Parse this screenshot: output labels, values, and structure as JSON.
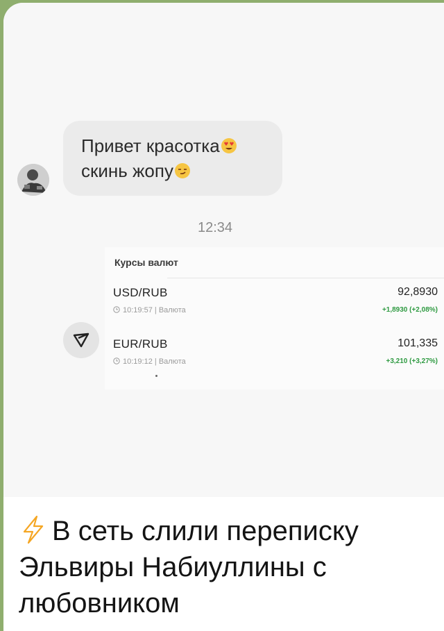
{
  "chat": {
    "message_line1": "Привет красотка",
    "message_line2": "скинь жопу",
    "time": "12:34"
  },
  "rates": {
    "title": "Курсы валют",
    "items": [
      {
        "pair": "USD/RUB",
        "time": "10:19:57",
        "source": "Валюта",
        "value": "92,8930",
        "change": "+1,8930 (+2,08%)"
      },
      {
        "pair": "EUR/RUB",
        "time": "10:19:12",
        "source": "Валюта",
        "value": "101,335",
        "change": "+3,210 (+3,27%)"
      }
    ]
  },
  "caption": {
    "line1": "В сеть слили переписку",
    "line2": "Эльвиры Набиуллины с",
    "line3": "любовником"
  },
  "colors": {
    "frame": "#8fae6e",
    "bubble": "#ebebeb",
    "positive": "#2e9a41",
    "bolt": "#f5a623"
  },
  "icons": [
    "avatar-image",
    "heart-eyes-emoji",
    "smirk-emoji",
    "clock-icon",
    "send-arrow-icon",
    "lightning-bolt-icon"
  ]
}
